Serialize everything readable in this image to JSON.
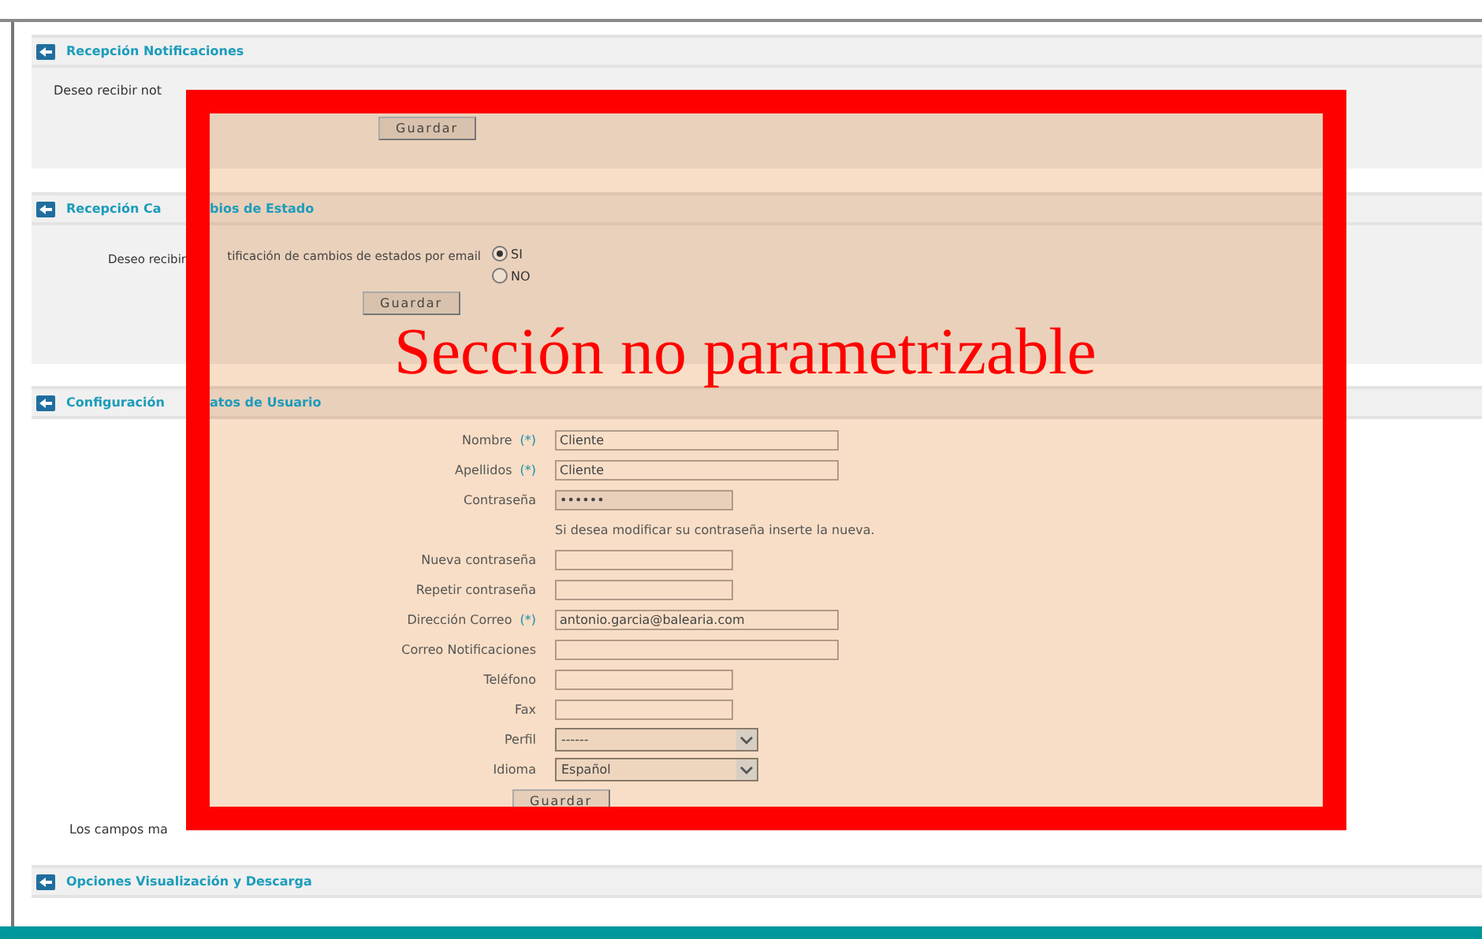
{
  "sections": [
    {
      "kind": "notifications",
      "title": [
        "Recepción Notificaciones"
      ],
      "question": [
        "Deseo recibir not"
      ],
      "button": "Guardar"
    },
    {
      "kind": "radio",
      "title": [
        "Recepción Ca",
        "bios de Estado"
      ],
      "question": [
        "Deseo recibir",
        "tificación de cambios de estados por email"
      ],
      "options": [
        {
          "label": "SI",
          "selected": true
        },
        {
          "label": "NO",
          "selected": false
        }
      ],
      "button": "Guardar"
    },
    {
      "kind": "form",
      "title": [
        "Configuración",
        "atos de Usuario"
      ],
      "fields": [
        {
          "kind": "wide_text",
          "label": "Nombre",
          "marker": "(*)",
          "value": "Cliente"
        },
        {
          "kind": "wide_text",
          "label": "Apellidos",
          "marker": "(*)",
          "value": "Cliente"
        },
        {
          "kind": "password",
          "label": "Contraseña",
          "value": "••••••"
        },
        {
          "kind": "hint",
          "text": "Si desea modificar su contraseña inserte la nueva."
        },
        {
          "kind": "text",
          "label": "Nueva contraseña"
        },
        {
          "kind": "text",
          "label": "Repetir contraseña"
        },
        {
          "kind": "wide_text",
          "label": "Dirección Correo",
          "marker": "(*)",
          "value": "antonio.garcia@balearia.com"
        },
        {
          "kind": "wide_text",
          "label": "Correo Notificaciones"
        },
        {
          "kind": "text",
          "label": "Teléfono"
        },
        {
          "kind": "text",
          "label": "Fax"
        },
        {
          "kind": "select",
          "label": "Perfil",
          "value": "------"
        },
        {
          "kind": "select",
          "label": "Idioma",
          "value": "Español"
        }
      ],
      "button": "Guardar",
      "note": "Los campos ma"
    },
    {
      "kind": "collapsed",
      "title": [
        "Opciones Visualización y Descarga"
      ]
    }
  ],
  "overlay": {
    "text": "Sección no parametrizable"
  }
}
